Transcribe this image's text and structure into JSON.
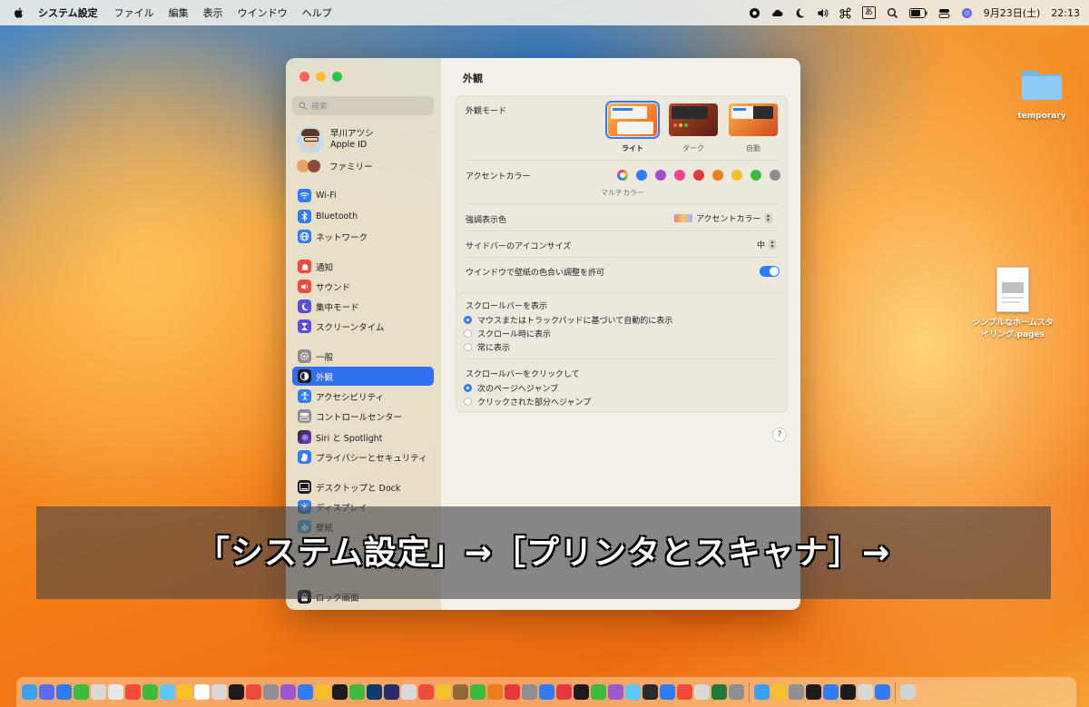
{
  "menubar": {
    "app_name": "システム設定",
    "menus": [
      "ファイル",
      "編集",
      "表示",
      "ウインドウ",
      "ヘルプ"
    ],
    "ime": "あ",
    "date": "9月23日(土)",
    "time": "22:13"
  },
  "sidebar": {
    "search_placeholder": "検索",
    "profile_name": "早川アツシ",
    "profile_sub": "Apple ID",
    "family": "ファミリー",
    "items": [
      {
        "label": "Wi-Fi",
        "color": "#2f7cf6"
      },
      {
        "label": "Bluetooth",
        "color": "#2f7cf6"
      },
      {
        "label": "ネットワーク",
        "color": "#2f7cf6"
      },
      {
        "label": "通知",
        "color": "#f04a3e"
      },
      {
        "label": "サウンド",
        "color": "#f04a3e"
      },
      {
        "label": "集中モード",
        "color": "#5a4fd6"
      },
      {
        "label": "スクリーンタイム",
        "color": "#5a4fd6"
      },
      {
        "label": "一般",
        "color": "#8e8e93"
      },
      {
        "label": "外観",
        "color": "#1c1c1e"
      },
      {
        "label": "アクセシビリティ",
        "color": "#2f7cf6"
      },
      {
        "label": "コントロールセンター",
        "color": "#8e8e93"
      },
      {
        "label": "Siri と Spotlight",
        "color": "#b24bd8"
      },
      {
        "label": "プライバシーとセキュリティ",
        "color": "#2f7cf6"
      },
      {
        "label": "デスクトップと Dock",
        "color": "#1c1c1e"
      },
      {
        "label": "ディスプレイ",
        "color": "#2f7cf6"
      },
      {
        "label": "壁紙",
        "color": "#38b6e8"
      },
      {
        "label": "ロック画面",
        "color": "#1c1c1e"
      }
    ],
    "selected": "外観"
  },
  "content": {
    "title": "外観",
    "appearance_mode_label": "外観モード",
    "modes": [
      "ライト",
      "ダーク",
      "自動"
    ],
    "accent_label": "アクセントカラー",
    "accent_multicolor": "マルチカラー",
    "accent_colors": [
      "#2f7cf6",
      "#a14fd0",
      "#e9468f",
      "#e5383b",
      "#f07d1d",
      "#f5c12b",
      "#3dbb3d",
      "#8e8e8e"
    ],
    "highlight_label": "強調表示色",
    "highlight_value": "アクセントカラー",
    "icon_size_label": "サイドバーのアイコンサイズ",
    "icon_size_value": "中",
    "tint_label": "ウインドウで壁紙の色合い調整を許可",
    "tint_enabled": true,
    "scrollbar_show_label": "スクロールバーを表示",
    "scrollbar_show_options": [
      "マウスまたはトラックパッドに基づいて自動的に表示",
      "スクロール時に表示",
      "常に表示"
    ],
    "scrollbar_click_label": "スクロールバーをクリックして",
    "scrollbar_click_options": [
      "次のページへジャンプ",
      "クリックされた部分へジャンプ"
    ],
    "help": "?"
  },
  "desktop": {
    "folder_name": "temporary",
    "doc_name_1": "シンプルなホームスタ",
    "doc_name_2": "イリング.pages"
  },
  "caption": "「システム設定」→［プリンタとスキャナ］→"
}
